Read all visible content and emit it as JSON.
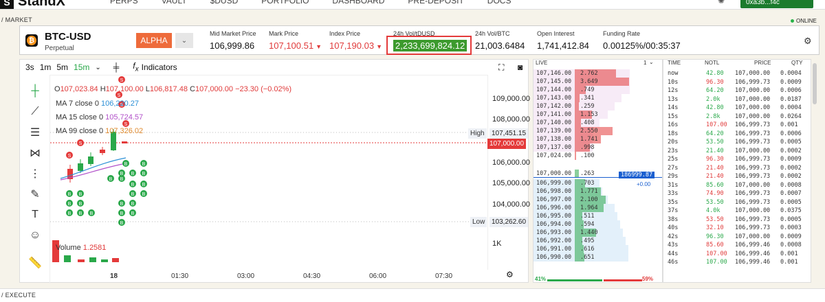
{
  "nav": {
    "brand": "StandX",
    "items": [
      "PERPS",
      "VAULT",
      "$DUSD",
      "PORTFOLIO",
      "DASHBOARD",
      "PRE-DEPOSIT",
      "DOCS"
    ],
    "wallet": "0xa3b...f4c"
  },
  "sections": {
    "market": "/ MARKET",
    "execute": "/ EXECUTE",
    "online": "ONLINE"
  },
  "ticker": {
    "symbol": "BTC-USD",
    "type": "Perpetual",
    "badge": "ALPHA",
    "stats": [
      {
        "label": "Mid Market Price",
        "value": "106,999.86",
        "tone": "neutral",
        "arrow": ""
      },
      {
        "label": "Mark Price",
        "value": "107,100.51",
        "tone": "red",
        "arrow": "▼"
      },
      {
        "label": "Index Price",
        "value": "107,190.03",
        "tone": "red",
        "arrow": "▼"
      },
      {
        "label": "24h Vol/tDUSD",
        "value": "2,233,699,824.12",
        "tone": "highlight",
        "arrow": ""
      },
      {
        "label": "24h Vol/BTC",
        "value": "21,003.6484",
        "tone": "neutral",
        "arrow": ""
      },
      {
        "label": "Open Interest",
        "value": "1,741,412.84",
        "tone": "neutral",
        "arrow": ""
      },
      {
        "label": "Funding Rate",
        "value": "0.00125%/00:35:37",
        "tone": "neutral",
        "arrow": ""
      }
    ]
  },
  "chart_toolbar": {
    "intervals": [
      "3s",
      "1m",
      "5m",
      "15m"
    ],
    "active": "15m",
    "indicators": "Indicators"
  },
  "ohlc": {
    "o_label": "O",
    "o": "107,023.84",
    "h_label": "H",
    "h": "107,100.00",
    "l_label": "L",
    "l": "106,817.48",
    "c_label": "C",
    "c": "107,000.00",
    "change": "−23.30 (−0.02%)"
  },
  "ma": [
    {
      "label": "MA 7 close 0",
      "value": "106,220.27",
      "color": "#2a8fd6"
    },
    {
      "label": "MA 15 close 0",
      "value": "105,724.57",
      "color": "#b150c9"
    },
    {
      "label": "MA 99 close 0",
      "value": "107,326.02",
      "color": "#e08a2e"
    }
  ],
  "volume": {
    "label": "Volume",
    "value": "1.2581"
  },
  "high_tag": {
    "label": "High",
    "value": "107,451.15"
  },
  "low_tag": {
    "label": "Low",
    "value": "103,262.60"
  },
  "last_price": "107,000.00",
  "chart_data": {
    "type": "candlestick",
    "y_ticks": [
      "109,000.00",
      "108,000.00",
      "106,000.00",
      "105,000.00",
      "104,000.00",
      "1K"
    ],
    "x_ticks": [
      "18",
      "01:30",
      "03:00",
      "04:30",
      "06:00",
      "07:30"
    ]
  },
  "orderbook": {
    "header": "LIVE",
    "precision": "1",
    "asks": [
      {
        "price": "107,146.00",
        "size": "2.762"
      },
      {
        "price": "107,145.00",
        "size": "3.649"
      },
      {
        "price": "107,144.00",
        "size": ".749"
      },
      {
        "price": "107,143.00",
        "size": ".341"
      },
      {
        "price": "107,142.00",
        "size": ".259"
      },
      {
        "price": "107,141.00",
        "size": "1.153"
      },
      {
        "price": "107,140.00",
        "size": ".408"
      },
      {
        "price": "107,139.00",
        "size": "2.550"
      },
      {
        "price": "107,138.00",
        "size": "1.741"
      },
      {
        "price": "107,137.00",
        "size": ".998"
      },
      {
        "price": "107,024.00",
        "size": ".100"
      }
    ],
    "mid": {
      "price": "107,000.00",
      "size": ".263",
      "badge": "186999.87",
      "delta": "+0.00"
    },
    "bids": [
      {
        "price": "106,999.00",
        "size": ".703"
      },
      {
        "price": "106,998.00",
        "size": "1.771"
      },
      {
        "price": "106,997.00",
        "size": "2.100"
      },
      {
        "price": "106,996.00",
        "size": "1.964"
      },
      {
        "price": "106,995.00",
        "size": ".511"
      },
      {
        "price": "106,994.00",
        "size": ".594"
      },
      {
        "price": "106,993.00",
        "size": "1.440"
      },
      {
        "price": "106,992.00",
        "size": ".495"
      },
      {
        "price": "106,991.00",
        "size": ".616"
      },
      {
        "price": "106,990.00",
        "size": ".651"
      }
    ],
    "buy_pct": "41%",
    "sell_pct": "59%"
  },
  "trades": {
    "headers": [
      "TIME",
      "NOTL",
      "PRICE",
      "QTY"
    ],
    "rows": [
      {
        "time": "now",
        "notl": "42.80",
        "price": "107,000.00",
        "qty": "0.0004",
        "side": "buy"
      },
      {
        "time": "10s",
        "notl": "96.30",
        "price": "106,999.73",
        "qty": "0.0009",
        "side": "sell"
      },
      {
        "time": "12s",
        "notl": "64.20",
        "price": "107,000.00",
        "qty": "0.0006",
        "side": "buy"
      },
      {
        "time": "13s",
        "notl": "2.0k",
        "price": "107,000.00",
        "qty": "0.0187",
        "side": "buy"
      },
      {
        "time": "14s",
        "notl": "42.80",
        "price": "107,000.00",
        "qty": "0.0004",
        "side": "buy"
      },
      {
        "time": "15s",
        "notl": "2.8k",
        "price": "107,000.00",
        "qty": "0.0264",
        "side": "buy"
      },
      {
        "time": "16s",
        "notl": "107.00",
        "price": "106,999.73",
        "qty": "0.001",
        "side": "sell"
      },
      {
        "time": "18s",
        "notl": "64.20",
        "price": "106,999.73",
        "qty": "0.0006",
        "side": "buy"
      },
      {
        "time": "20s",
        "notl": "53.50",
        "price": "106,999.73",
        "qty": "0.0005",
        "side": "buy"
      },
      {
        "time": "23s",
        "notl": "21.40",
        "price": "107,000.00",
        "qty": "0.0002",
        "side": "buy"
      },
      {
        "time": "25s",
        "notl": "96.30",
        "price": "106,999.73",
        "qty": "0.0009",
        "side": "sell"
      },
      {
        "time": "27s",
        "notl": "21.40",
        "price": "106,999.73",
        "qty": "0.0002",
        "side": "sell"
      },
      {
        "time": "29s",
        "notl": "21.40",
        "price": "106,999.73",
        "qty": "0.0002",
        "side": "sell"
      },
      {
        "time": "31s",
        "notl": "85.60",
        "price": "107,000.00",
        "qty": "0.0008",
        "side": "buy"
      },
      {
        "time": "33s",
        "notl": "74.90",
        "price": "106,999.73",
        "qty": "0.0007",
        "side": "sell"
      },
      {
        "time": "35s",
        "notl": "53.50",
        "price": "106,999.73",
        "qty": "0.0005",
        "side": "buy"
      },
      {
        "time": "37s",
        "notl": "4.0k",
        "price": "107,000.00",
        "qty": "0.0375",
        "side": "buy"
      },
      {
        "time": "38s",
        "notl": "53.50",
        "price": "106,999.73",
        "qty": "0.0005",
        "side": "sell"
      },
      {
        "time": "40s",
        "notl": "32.10",
        "price": "106,999.73",
        "qty": "0.0003",
        "side": "sell"
      },
      {
        "time": "42s",
        "notl": "96.30",
        "price": "107,000.00",
        "qty": "0.0009",
        "side": "buy"
      },
      {
        "time": "43s",
        "notl": "85.60",
        "price": "106,999.46",
        "qty": "0.0008",
        "side": "sell"
      },
      {
        "time": "44s",
        "notl": "107.00",
        "price": "106,999.46",
        "qty": "0.001",
        "side": "sell"
      },
      {
        "time": "46s",
        "notl": "107.00",
        "price": "106,999.46",
        "qty": "0.001",
        "side": "buy"
      }
    ]
  }
}
